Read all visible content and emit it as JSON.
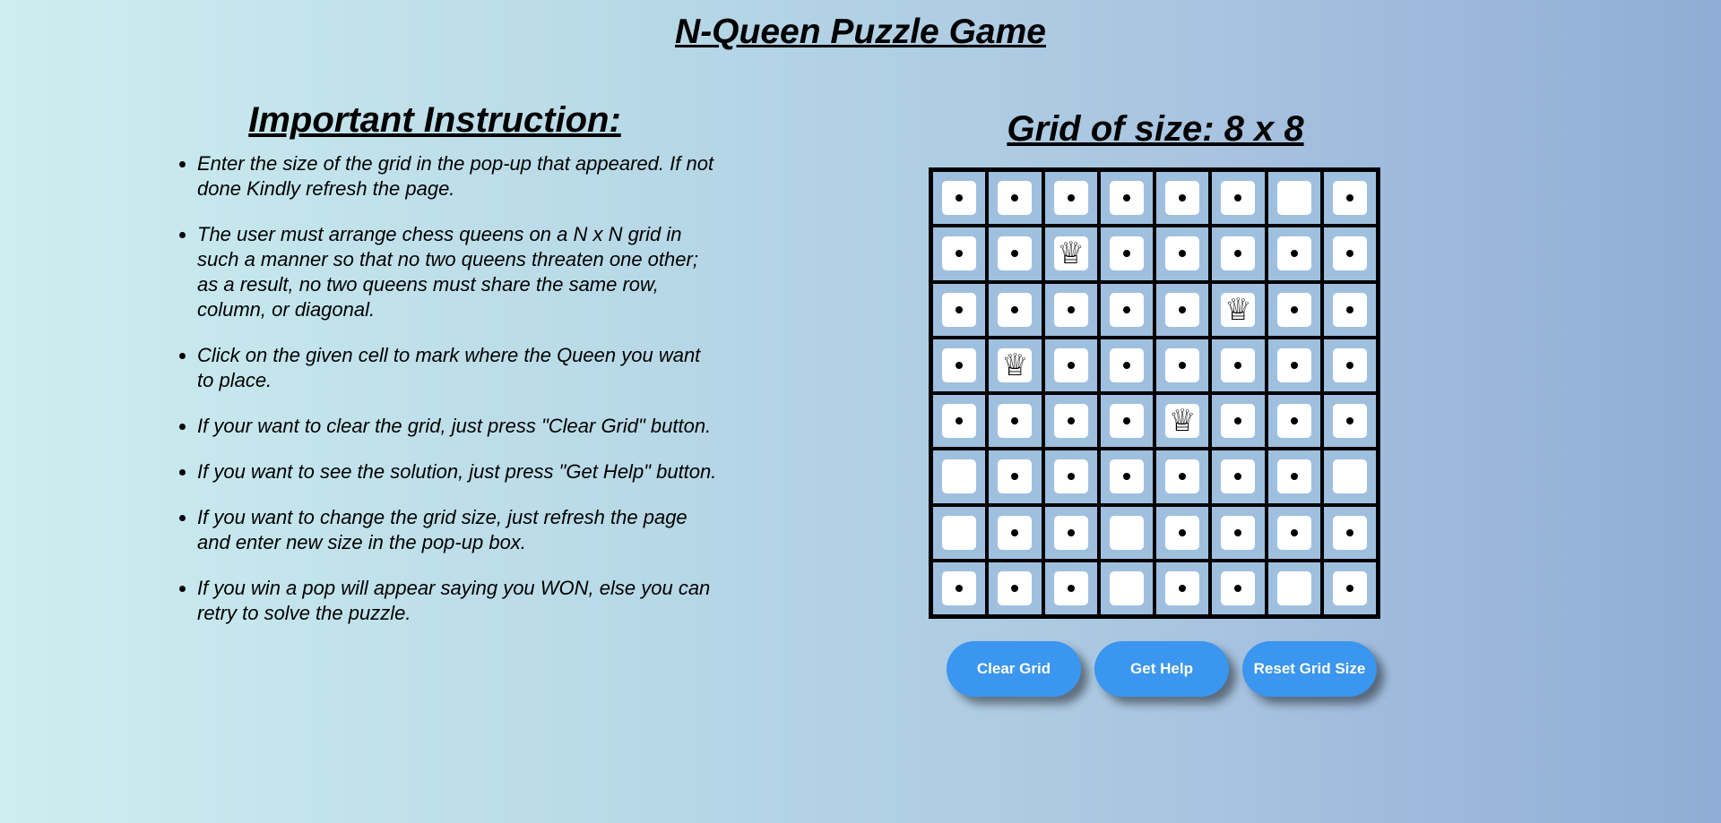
{
  "page": {
    "title": "N-Queen Puzzle Game"
  },
  "instructions": {
    "heading": "Important Instruction:",
    "items": [
      "Enter the size of the grid in the pop-up that appeared. If not done Kindly refresh the page.",
      "The user must arrange chess queens on a N x N grid in such a manner so that no two queens threaten one other; as a result, no two queens must share the same row, column, or diagonal.",
      "Click on the given cell to mark where the Queen you want to place.",
      "If your want to clear the grid, just press \"Clear Grid\" button.",
      "If you want to see the solution, just press \"Get Help\" button.",
      "If you want to change the grid size, just refresh the page and enter new size in the pop-up box.",
      "If you win a pop will appear saying you WON, else you can retry to solve the puzzle."
    ]
  },
  "grid": {
    "title": "Grid of size: 8 x 8",
    "size": 8,
    "queen_glyph": "♕",
    "legend": {
      "Q": "queen",
      "D": "attacked-dot",
      "E": "empty"
    },
    "rows": [
      "DDDDDDED",
      "DDQDDDDD",
      "DDDDDQDD",
      "DQDDDDDD",
      "DDDDQDDD",
      "EDDDDDDE",
      "EDDEDDDD",
      "DDDEDDED"
    ]
  },
  "buttons": {
    "clear": "Clear Grid",
    "help": "Get Help",
    "reset": "Reset Grid Size"
  },
  "colors": {
    "button": "#3a96ee",
    "cell_bg": "#9fbfdf"
  }
}
